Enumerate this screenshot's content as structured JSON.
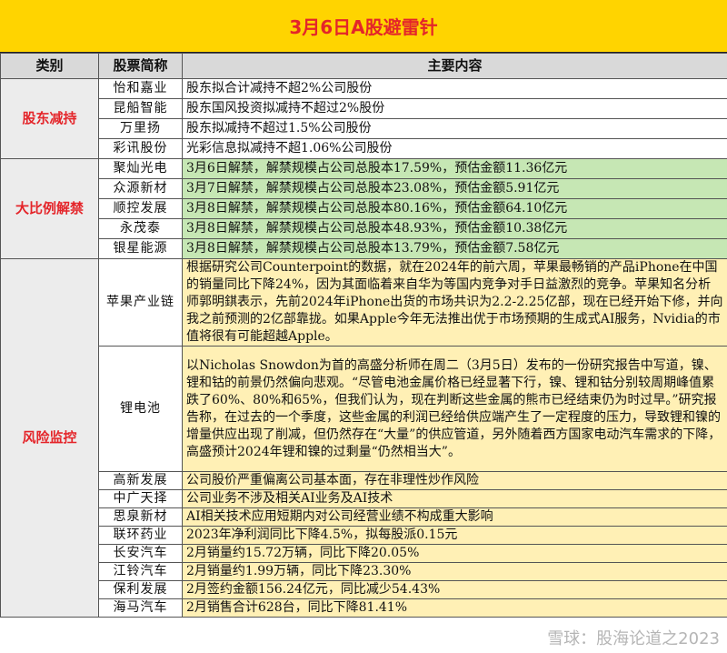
{
  "title": "3月6日A股避雷针",
  "headers": {
    "category": "类别",
    "stock": "股票简称",
    "content": "主要内容"
  },
  "sections": [
    {
      "category": "股东减持",
      "rows": [
        {
          "name": "怡和嘉业",
          "content": "股东拟合计减持不超2%公司股份"
        },
        {
          "name": "昆船智能",
          "content": "股东国风投资拟减持不超过2%股份"
        },
        {
          "name": "万里扬",
          "content": "股东拟减持不超过1.5%公司股份"
        },
        {
          "name": "彩讯股份",
          "content": "光彩信息拟减持不超1.06%公司股份"
        }
      ]
    },
    {
      "category": "大比例解禁",
      "rows": [
        {
          "name": "聚灿光电",
          "content": "3月6日解禁，解禁规模占公司总股本17.59%，预估金额11.36亿元"
        },
        {
          "name": "众源新材",
          "content": "3月7日解禁，解禁规模占公司总股本23.08%，预估金额5.91亿元"
        },
        {
          "name": "顺控发展",
          "content": "3月8日解禁，解禁规模占公司总股本80.16%，预估金额64.10亿元"
        },
        {
          "name": "永茂泰",
          "content": "3月8日解禁，解禁规模占公司总股本48.93%，预估金额10.38亿元"
        },
        {
          "name": "银星能源",
          "content": "3月8日解禁，解禁规模占公司总股本13.79%，预估金额7.58亿元"
        }
      ]
    },
    {
      "category": "风险监控",
      "rows": [
        {
          "name": "苹果产业链",
          "content": "根据研究公司Counterpoint的数据，就在2024年的前六周，苹果最畅销的产品iPhone在中国的销量同比下降24%，因为其面临着来自华为等国内竞争对手日益激烈的竞争。苹果知名分析师郭明錤表示，先前2024年iPhone出货的市场共识为2.2-2.25亿部，现在已经开始下修，并向我之前预测的2亿部靠拢。如果Apple今年无法推出优于市场预期的生成式AI服务，Nvidia的市值将很有可能超越Apple。"
        },
        {
          "name": "锂电池",
          "content": "以Nicholas Snowdon为首的高盛分析师在周二（3月5日）发布的一份研究报告中写道，镍、锂和钴的前景仍然偏向悲观。“尽管电池金属价格已经显著下行，镍、锂和钴分别较周期峰值累跌了60%、80%和65%，但我们认为，现在判断这些金属的熊市已经结束仍为时过早。”研究报告称，在过去的一个季度，这些金属的利润已经给供应端产生了一定程度的压力，导致锂和镍的增量供应出现了削减，但仍然存在“大量”的供应管道，另外随着西方国家电动汽车需求的下降，高盛预计2024年锂和镍的过剩量“仍然相当大”。"
        },
        {
          "name": "高新发展",
          "content": "公司股价严重偏离公司基本面，存在非理性炒作风险"
        },
        {
          "name": "中广天择",
          "content": "公司业务不涉及相关AI业务及AI技术"
        },
        {
          "name": "思泉新材",
          "content": "AI相关技术应用短期内对公司经营业绩不构成重大影响"
        },
        {
          "name": "联环药业",
          "content": "2023年净利润同比下降4.5%，拟每股派0.15元"
        },
        {
          "name": "长安汽车",
          "content": "2月销量约15.72万辆，同比下降20.05%"
        },
        {
          "name": "江铃汽车",
          "content": "2月销量约1.99万辆，同比下降23.30%"
        },
        {
          "name": "保利发展",
          "content": "2月签约金额156.24亿元，同比减少54.43%"
        },
        {
          "name": "海马汽车",
          "content": "2月销售合计628台，同比下降81.41%"
        }
      ]
    }
  ],
  "watermark": "雪球：股海论道之2023",
  "colors": {
    "title_bg": "#ffd400",
    "title_text": "#e4252a",
    "green": "#c6e7b4",
    "yellow": "#fff0b5"
  }
}
